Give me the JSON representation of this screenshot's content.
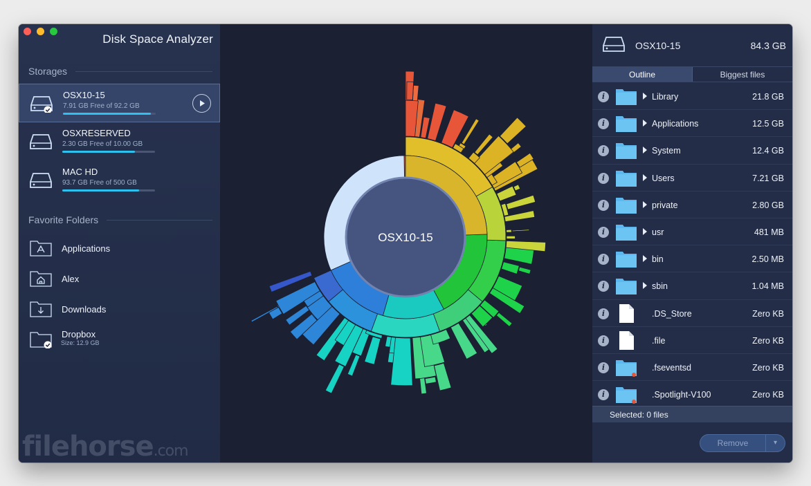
{
  "app": {
    "title": "Disk Space Analyzer"
  },
  "sidebar": {
    "storages_heading": "Storages",
    "storages": [
      {
        "name": "OSX10-15",
        "free": "7.91 GB Free of 92.2 GB",
        "used_fraction": 0.95,
        "selected": true
      },
      {
        "name": "OSXRESERVED",
        "free": "2.30 GB Free of 10.00 GB",
        "used_fraction": 0.78,
        "selected": false
      },
      {
        "name": "MAC HD",
        "free": "93.7 GB Free of 500 GB",
        "used_fraction": 0.83,
        "selected": false
      }
    ],
    "favorites_heading": "Favorite Folders",
    "favorites": [
      {
        "name": "Applications",
        "icon": "applications-folder-icon"
      },
      {
        "name": "Alex",
        "icon": "home-folder-icon"
      },
      {
        "name": "Downloads",
        "icon": "downloads-folder-icon"
      },
      {
        "name": "Dropbox",
        "icon": "dropbox-folder-icon",
        "sub": "Size: 12.9 GB"
      }
    ]
  },
  "sunburst": {
    "center_label": "OSX10-15"
  },
  "right_panel": {
    "disk_name": "OSX10-15",
    "disk_size": "84.3 GB",
    "tabs": [
      "Outline",
      "Biggest files"
    ],
    "active_tab": "Outline",
    "items": [
      {
        "name": "Library",
        "size": "21.8 GB",
        "type": "folder",
        "expandable": true
      },
      {
        "name": "Applications",
        "size": "12.5 GB",
        "type": "folder",
        "expandable": true
      },
      {
        "name": "System",
        "size": "12.4 GB",
        "type": "folder",
        "expandable": true
      },
      {
        "name": "Users",
        "size": "7.21 GB",
        "type": "folder",
        "expandable": true
      },
      {
        "name": "private",
        "size": "2.80 GB",
        "type": "folder",
        "expandable": true
      },
      {
        "name": "usr",
        "size": "481 MB",
        "type": "folder",
        "expandable": true
      },
      {
        "name": "bin",
        "size": "2.50 MB",
        "type": "folder",
        "expandable": true
      },
      {
        "name": "sbin",
        "size": "1.04 MB",
        "type": "folder",
        "expandable": true
      },
      {
        "name": ".DS_Store",
        "size": "Zero KB",
        "type": "file",
        "expandable": false
      },
      {
        "name": ".file",
        "size": "Zero KB",
        "type": "file",
        "expandable": false
      },
      {
        "name": ".fseventsd",
        "size": "Zero KB",
        "type": "folder-locked",
        "expandable": false
      },
      {
        "name": ".Spotlight-V100",
        "size": "Zero KB",
        "type": "folder-locked",
        "expandable": false
      }
    ],
    "selected_text": "Selected: 0 files",
    "remove_label": "Remove",
    "remove_dropdown": "▾"
  },
  "watermark": {
    "main": "filehorse",
    "suffix": ".com"
  },
  "colors": {
    "accent": "#2dc1f0",
    "folder": "#5cb8ee",
    "window_bg": "#1b2032"
  }
}
